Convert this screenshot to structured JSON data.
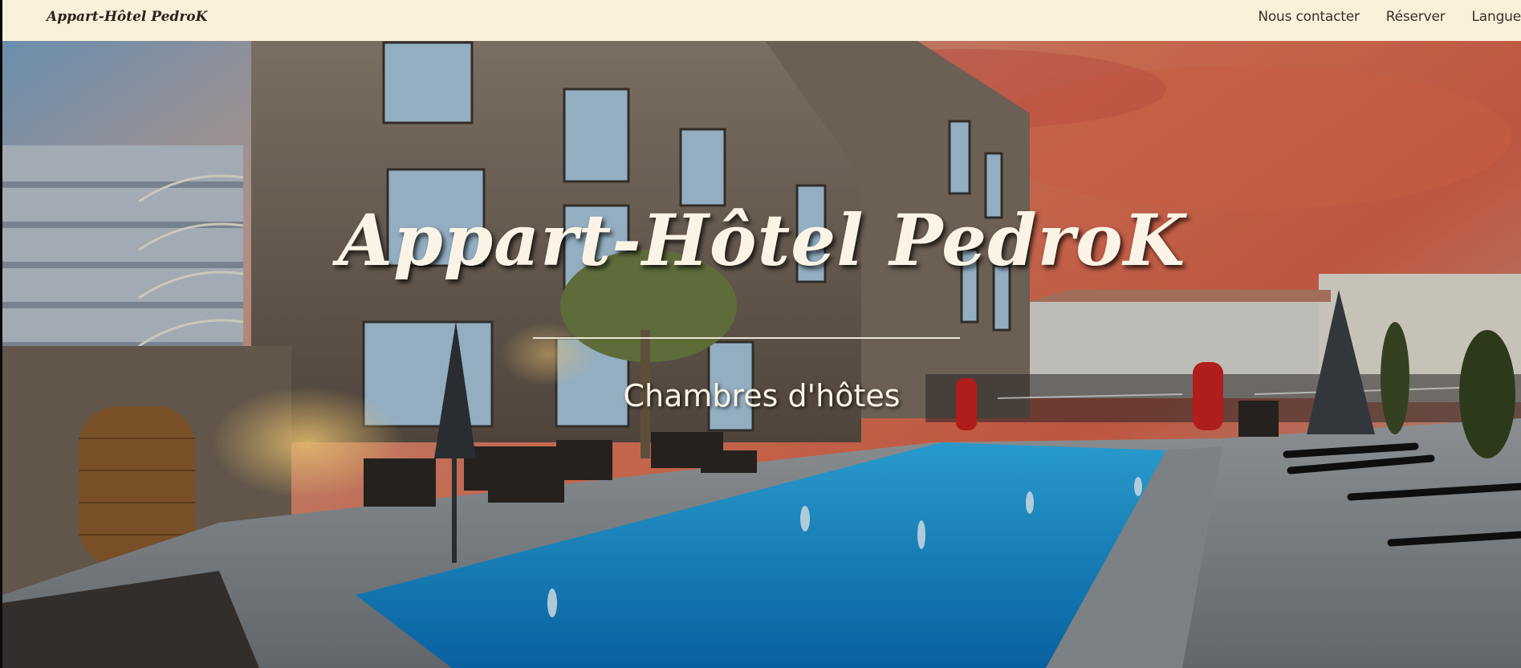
{
  "site": {
    "brand": "Appart-Hôtel PedroK"
  },
  "nav": {
    "items": [
      {
        "label": "Nous contacter"
      },
      {
        "label": "Réserver"
      },
      {
        "label": "Langue"
      }
    ]
  },
  "hero": {
    "title": "Appart-Hôtel PedroK",
    "subtitle": "Chambres d'hôtes"
  }
}
